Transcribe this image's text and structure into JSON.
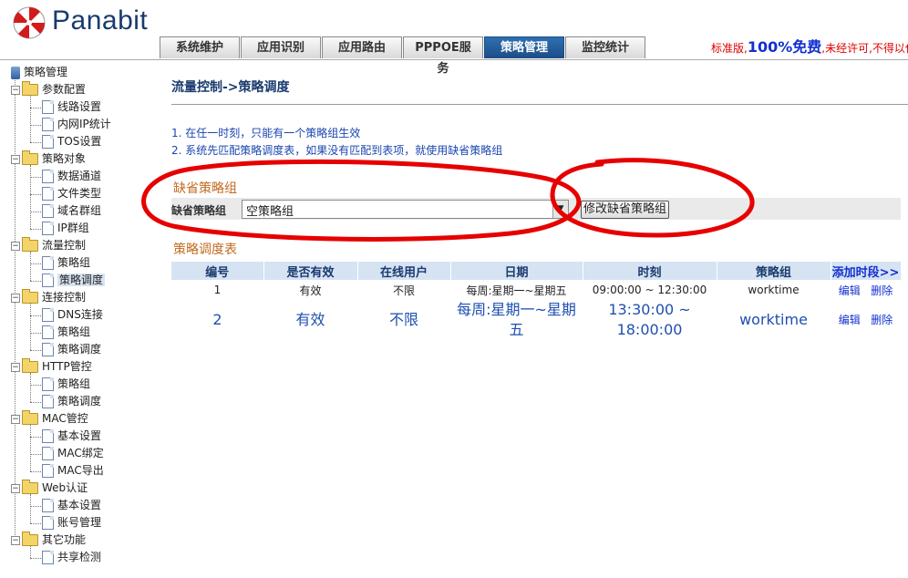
{
  "header": {
    "brand": "Panabit",
    "tabs": [
      {
        "label": "系统维护",
        "active": false
      },
      {
        "label": "应用识别",
        "active": false
      },
      {
        "label": "应用路由",
        "active": false
      },
      {
        "label": "PPPOE服务",
        "active": false
      },
      {
        "label": "策略管理",
        "active": true
      },
      {
        "label": "监控统计",
        "active": false
      }
    ],
    "notice_prefix": "标准版,",
    "notice_big": "100%免费",
    "notice_suffix": ",未经许可,不得以任"
  },
  "sidebar": {
    "root": "策略管理",
    "groups": [
      {
        "label": "参数配置",
        "items": [
          "线路设置",
          "内网IP统计",
          "TOS设置"
        ]
      },
      {
        "label": "策略对象",
        "items": [
          "数据通道",
          "文件类型",
          "域名群组",
          "IP群组"
        ]
      },
      {
        "label": "流量控制",
        "items": [
          "策略组",
          "策略调度"
        ]
      },
      {
        "label": "连接控制",
        "items": [
          "DNS连接",
          "策略组",
          "策略调度"
        ]
      },
      {
        "label": "HTTP管控",
        "items": [
          "策略组",
          "策略调度"
        ]
      },
      {
        "label": "MAC管控",
        "items": [
          "基本设置",
          "MAC绑定",
          "MAC导出"
        ]
      },
      {
        "label": "Web认证",
        "items": [
          "基本设置",
          "账号管理"
        ]
      },
      {
        "label": "其它功能",
        "items": [
          "共享检测"
        ]
      }
    ],
    "selected": "流量控制/策略调度"
  },
  "main": {
    "title": "流量控制->策略调度",
    "notes": [
      "1. 在任一时刻，只能有一个策略组生效",
      "2. 系统先匹配策略调度表，如果没有匹配到表项，就使用缺省策略组"
    ],
    "default_section": "缺省策略组",
    "default_label": "缺省策略组",
    "default_value": "空策略组",
    "modify_button": "修改缺省策略组",
    "table_section": "策略调度表",
    "columns": [
      "编号",
      "是否有效",
      "在线用户",
      "日期",
      "时刻",
      "策略组",
      "添加时段>>"
    ],
    "rows": [
      {
        "id": "1",
        "valid": "有效",
        "users": "不限",
        "date": "每周:星期一~星期五",
        "time": "09:00:00 ~ 12:30:00",
        "group": "worktime",
        "edit": "编辑",
        "delete": "删除"
      },
      {
        "id": "2",
        "valid": "有效",
        "users": "不限",
        "date": "每周:星期一~星期五",
        "time": "13:30:00 ~ 18:00:00",
        "group": "worktime",
        "edit": "编辑",
        "delete": "删除"
      }
    ]
  },
  "colors": {
    "annotation": "#e60000",
    "brand": "#1a3a6e",
    "active_tab": "#1b4d87",
    "table_header": "#d6e3f3",
    "section_head": "#c36a1f",
    "link": "#1230d0"
  }
}
